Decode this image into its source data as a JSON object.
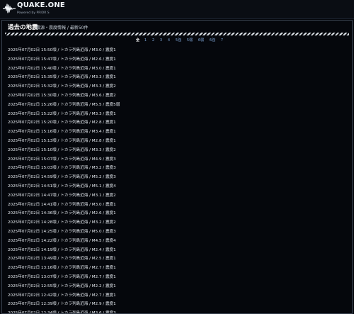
{
  "header": {
    "app_title": "QUAKE.ONE",
    "powered_by": "Powered by PRIOR S"
  },
  "panel": {
    "title": "過去の地震",
    "subtitle": "震源・震度情報 / 最新50件"
  },
  "pager": [
    "全",
    "1",
    "2",
    "3",
    "4",
    "5強",
    "5弱",
    "6弱",
    "6強",
    "7"
  ],
  "pager_active": "全",
  "quakes": [
    "2025年07月02日 15:50頃 / トカラ列島近海 / M3.0 / 震度1",
    "2025年07月02日 15:47頃 / トカラ列島近海 / M2.6 / 震度1",
    "2025年07月02日 15:40頃 / トカラ列島近海 / M3.0 / 震度1",
    "2025年07月02日 15:35頃 / トカラ列島近海 / M3.3 / 震度1",
    "2025年07月02日 15:32頃 / トカラ列島近海 / M3.3 / 震度2",
    "2025年07月02日 15:30頃 / トカラ列島近海 / M3.6 / 震度2",
    "2025年07月02日 15:26頃 / トカラ列島近海 / M5.5 / 震度5弱",
    "2025年07月02日 15:22頃 / トカラ列島近海 / M3.3 / 震度1",
    "2025年07月02日 15:20頃 / トカラ列島近海 / M2.8 / 震度1",
    "2025年07月02日 15:16頃 / トカラ列島近海 / M3.4 / 震度1",
    "2025年07月02日 15:13頃 / トカラ列島近海 / M2.8 / 震度1",
    "2025年07月02日 15:10頃 / トカラ列島近海 / M3.3 / 震度2",
    "2025年07月02日 15:07頃 / トカラ列島近海 / M4.9 / 震度3",
    "2025年07月02日 15:03頃 / トカラ列島近海 / M3.2 / 震度3",
    "2025年07月02日 14:59頃 / トカラ列島近海 / M5.2 / 震度3",
    "2025年07月02日 14:51頃 / トカラ列島近海 / M5.1 / 震度4",
    "2025年07月02日 14:47頃 / トカラ列島近海 / M3.1 / 震度2",
    "2025年07月02日 14:41頃 / トカラ列島近海 / M3.0 / 震度1",
    "2025年07月02日 14:36頃 / トカラ列島近海 / M2.6 / 震度1",
    "2025年07月02日 14:28頃 / トカラ列島近海 / M3.2 / 震度2",
    "2025年07月02日 14:25頃 / トカラ列島近海 / M5.0 / 震度3",
    "2025年07月02日 14:22頃 / トカラ列島近海 / M4.5 / 震度4",
    "2025年07月02日 14:19頃 / トカラ列島近海 / M2.4 / 震度1",
    "2025年07月02日 13:49頃 / トカラ列島近海 / M2.5 / 震度1",
    "2025年07月02日 13:16頃 / トカラ列島近海 / M2.7 / 震度1",
    "2025年07月02日 13:07頃 / トカラ列島近海 / M2.7 / 震度1",
    "2025年07月02日 12:55頃 / トカラ列島近海 / M2.2 / 震度1",
    "2025年07月02日 12:42頃 / トカラ列島近海 / M2.7 / 震度1",
    "2025年07月02日 12:39頃 / トカラ列島近海 / M2.9 / 震度1",
    "2025年07月02日 12:34頃 / トカラ列島近海 / M3.6 / 震度3"
  ],
  "colors": {
    "background": "#05070c",
    "text": "#e6ebf1",
    "pager_link": "#7fa7d9",
    "panel_border": "#3a4350"
  },
  "icons": {
    "logo": "seismic-wave-icon"
  }
}
